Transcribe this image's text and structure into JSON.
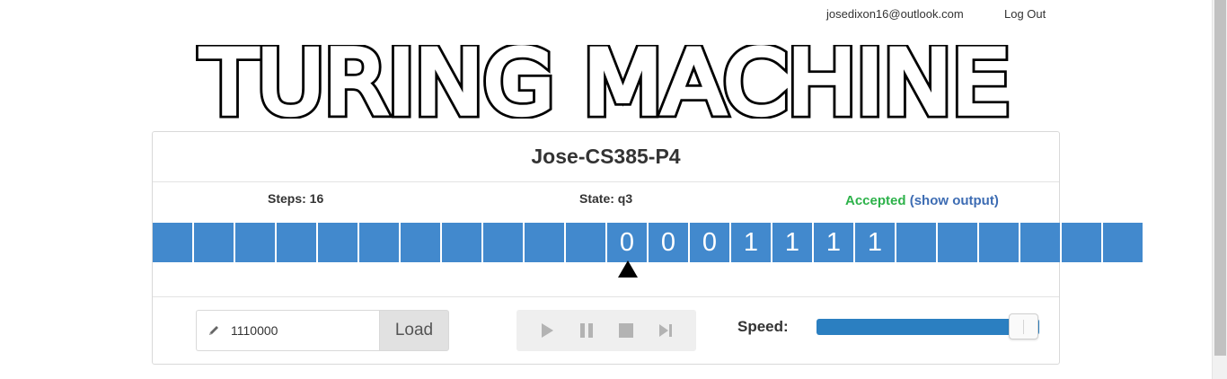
{
  "header": {
    "user_email": "josedixon16@outlook.com",
    "logout_label": "Log Out",
    "logo_text": "TURING MACHINE"
  },
  "machine": {
    "title": "Jose-CS385-P4",
    "steps_label": "Steps: 16",
    "state_label": "State: q3",
    "result_label": "Accepted",
    "show_output_label": "(show output)",
    "tape": [
      "",
      "",
      "",
      "",
      "",
      "",
      "",
      "",
      "",
      "",
      "",
      "0",
      "0",
      "0",
      "1",
      "1",
      "1",
      "1",
      "",
      "",
      "",
      "",
      "",
      ""
    ],
    "head_index": 11
  },
  "controls": {
    "input_value": "1110000",
    "load_label": "Load",
    "speed_label": "Speed:",
    "speed_level": 1.0,
    "icons": [
      "play-icon",
      "pause-icon",
      "stop-icon",
      "step-forward-icon"
    ]
  },
  "colors": {
    "tape_cell": "#4289cd",
    "accepted": "#2db24a",
    "link": "#3d6cb3",
    "speed_fill": "#2b7fc1"
  }
}
